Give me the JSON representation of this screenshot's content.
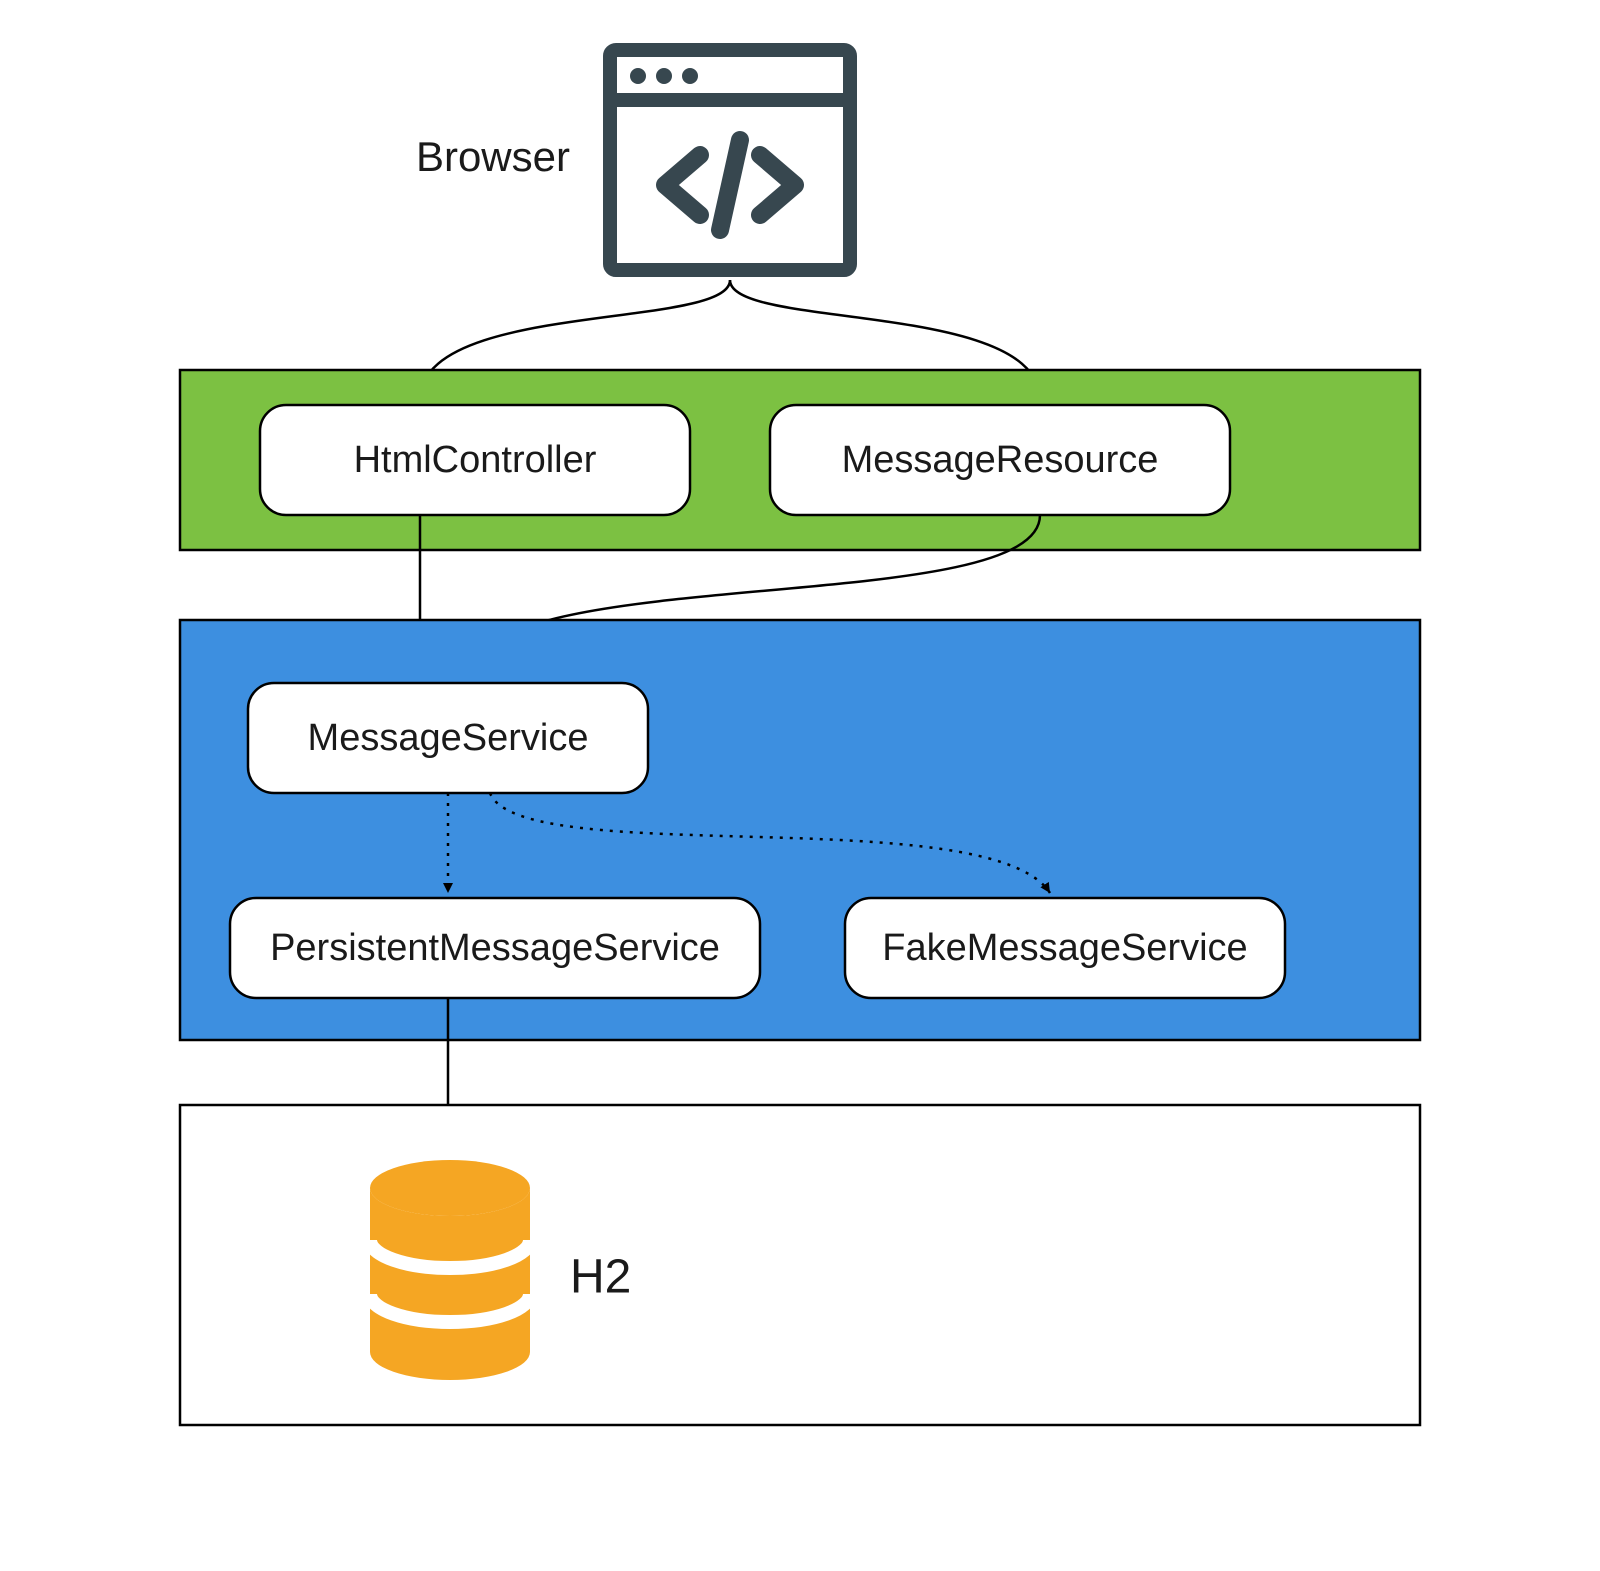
{
  "diagram": {
    "browser_label": "Browser",
    "layers": {
      "web": {
        "color": "#7cc142",
        "boxes": [
          {
            "id": "html_controller",
            "label": "HtmlController"
          },
          {
            "id": "message_resource",
            "label": "MessageResource"
          }
        ]
      },
      "service": {
        "color": "#3d8fe0",
        "boxes": [
          {
            "id": "message_service",
            "label": "MessageService"
          },
          {
            "id": "persistent_message_service",
            "label": "PersistentMessageService"
          },
          {
            "id": "fake_message_service",
            "label": "FakeMessageService"
          }
        ]
      },
      "db": {
        "color": "#ffffff",
        "label": "H2",
        "db_color": "#f5a623"
      }
    },
    "icon_color": "#37474f",
    "arrows": [
      {
        "from": "browser",
        "to": "html_controller",
        "style": "solid"
      },
      {
        "from": "browser",
        "to": "message_resource",
        "style": "solid"
      },
      {
        "from": "html_controller",
        "to": "message_service",
        "style": "solid"
      },
      {
        "from": "message_resource",
        "to": "message_service",
        "style": "solid"
      },
      {
        "from": "message_service",
        "to": "persistent_message_service",
        "style": "dotted"
      },
      {
        "from": "message_service",
        "to": "fake_message_service",
        "style": "dotted"
      },
      {
        "from": "persistent_message_service",
        "to": "h2",
        "style": "solid"
      }
    ]
  }
}
